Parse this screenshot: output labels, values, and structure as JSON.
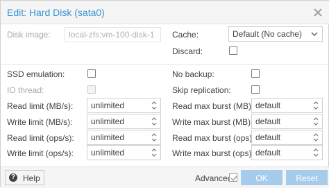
{
  "window": {
    "title": "Edit: Hard Disk (sata0)"
  },
  "fields": {
    "disk_image": {
      "label": "Disk image:",
      "value": "local-zfs:vm-100-disk-1"
    },
    "cache": {
      "label": "Cache:",
      "value": "Default (No cache)"
    },
    "discard": {
      "label": "Discard:"
    },
    "ssd_emulation": {
      "label": "SSD emulation:"
    },
    "no_backup": {
      "label": "No backup:"
    },
    "io_thread": {
      "label": "IO thread:"
    },
    "skip_replication": {
      "label": "Skip replication:"
    },
    "read_limit_mb": {
      "label": "Read limit (MB/s):",
      "value": "unlimited"
    },
    "read_max_burst_mb": {
      "label": "Read max burst (MB):",
      "value": "default"
    },
    "write_limit_mb": {
      "label": "Write limit (MB/s):",
      "value": "unlimited"
    },
    "write_max_burst_mb": {
      "label": "Write max burst (MB):",
      "value": "default"
    },
    "read_limit_ops": {
      "label": "Read limit (ops/s):",
      "value": "unlimited"
    },
    "read_max_burst_ops": {
      "label": "Read max burst (ops):",
      "value": "default"
    },
    "write_limit_ops": {
      "label": "Write limit (ops/s):",
      "value": "unlimited"
    },
    "write_max_burst_ops": {
      "label": "Write max burst (ops):",
      "value": "default"
    }
  },
  "footer": {
    "help_label": "Help",
    "advanced_label": "Advanced",
    "ok_label": "OK",
    "reset_label": "Reset"
  },
  "colors": {
    "title": "#3892d4",
    "primary_button_disabled": "#a6cbeb",
    "text": "#404040",
    "disabled_text": "#a8a8a8"
  },
  "icons": {
    "close": "close-icon",
    "help": "help-icon",
    "dropdown": "chevron-down-icon",
    "spinner": "spinner-icon",
    "checkmark": "checkmark-icon"
  }
}
